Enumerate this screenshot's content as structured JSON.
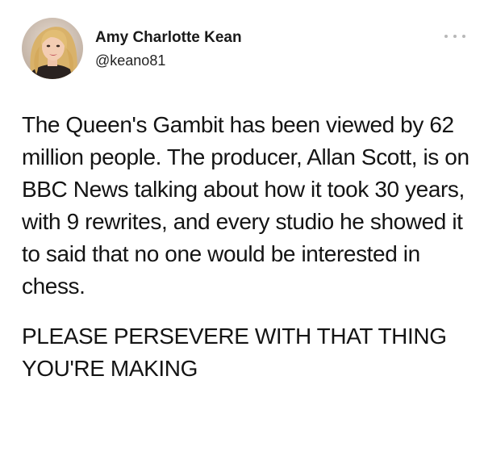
{
  "author": {
    "display_name": "Amy Charlotte Kean",
    "handle": "@keano81",
    "avatar_icon": "profile-photo"
  },
  "menu": {
    "icon": "more-options-icon"
  },
  "tweet": {
    "paragraphs": [
      "The Queen's Gambit has been viewed by 62 million people. The producer, Allan Scott, is on BBC News talking about how it took 30 years, with 9 rewrites, and every studio he showed it to said that no one would be interested in chess.",
      "PLEASE PERSEVERE WITH THAT THING YOU'RE MAKING"
    ]
  },
  "colors": {
    "background": "#ffffff",
    "text": "#141414",
    "menu_dots": "#b8b8b8"
  }
}
